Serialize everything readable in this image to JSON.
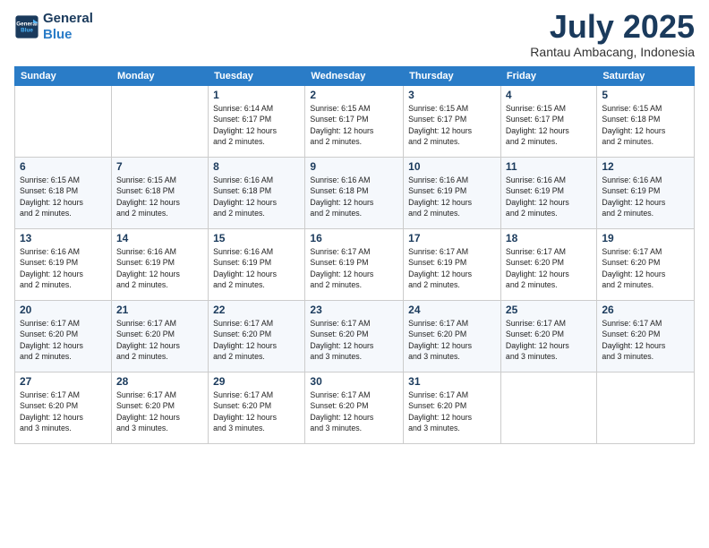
{
  "logo": {
    "line1": "General",
    "line2": "Blue"
  },
  "title": "July 2025",
  "location": "Rantau Ambacang, Indonesia",
  "days_of_week": [
    "Sunday",
    "Monday",
    "Tuesday",
    "Wednesday",
    "Thursday",
    "Friday",
    "Saturday"
  ],
  "weeks": [
    [
      {
        "day": "",
        "info": ""
      },
      {
        "day": "",
        "info": ""
      },
      {
        "day": "1",
        "info": "Sunrise: 6:14 AM\nSunset: 6:17 PM\nDaylight: 12 hours\nand 2 minutes."
      },
      {
        "day": "2",
        "info": "Sunrise: 6:15 AM\nSunset: 6:17 PM\nDaylight: 12 hours\nand 2 minutes."
      },
      {
        "day": "3",
        "info": "Sunrise: 6:15 AM\nSunset: 6:17 PM\nDaylight: 12 hours\nand 2 minutes."
      },
      {
        "day": "4",
        "info": "Sunrise: 6:15 AM\nSunset: 6:17 PM\nDaylight: 12 hours\nand 2 minutes."
      },
      {
        "day": "5",
        "info": "Sunrise: 6:15 AM\nSunset: 6:18 PM\nDaylight: 12 hours\nand 2 minutes."
      }
    ],
    [
      {
        "day": "6",
        "info": "Sunrise: 6:15 AM\nSunset: 6:18 PM\nDaylight: 12 hours\nand 2 minutes."
      },
      {
        "day": "7",
        "info": "Sunrise: 6:15 AM\nSunset: 6:18 PM\nDaylight: 12 hours\nand 2 minutes."
      },
      {
        "day": "8",
        "info": "Sunrise: 6:16 AM\nSunset: 6:18 PM\nDaylight: 12 hours\nand 2 minutes."
      },
      {
        "day": "9",
        "info": "Sunrise: 6:16 AM\nSunset: 6:18 PM\nDaylight: 12 hours\nand 2 minutes."
      },
      {
        "day": "10",
        "info": "Sunrise: 6:16 AM\nSunset: 6:19 PM\nDaylight: 12 hours\nand 2 minutes."
      },
      {
        "day": "11",
        "info": "Sunrise: 6:16 AM\nSunset: 6:19 PM\nDaylight: 12 hours\nand 2 minutes."
      },
      {
        "day": "12",
        "info": "Sunrise: 6:16 AM\nSunset: 6:19 PM\nDaylight: 12 hours\nand 2 minutes."
      }
    ],
    [
      {
        "day": "13",
        "info": "Sunrise: 6:16 AM\nSunset: 6:19 PM\nDaylight: 12 hours\nand 2 minutes."
      },
      {
        "day": "14",
        "info": "Sunrise: 6:16 AM\nSunset: 6:19 PM\nDaylight: 12 hours\nand 2 minutes."
      },
      {
        "day": "15",
        "info": "Sunrise: 6:16 AM\nSunset: 6:19 PM\nDaylight: 12 hours\nand 2 minutes."
      },
      {
        "day": "16",
        "info": "Sunrise: 6:17 AM\nSunset: 6:19 PM\nDaylight: 12 hours\nand 2 minutes."
      },
      {
        "day": "17",
        "info": "Sunrise: 6:17 AM\nSunset: 6:19 PM\nDaylight: 12 hours\nand 2 minutes."
      },
      {
        "day": "18",
        "info": "Sunrise: 6:17 AM\nSunset: 6:20 PM\nDaylight: 12 hours\nand 2 minutes."
      },
      {
        "day": "19",
        "info": "Sunrise: 6:17 AM\nSunset: 6:20 PM\nDaylight: 12 hours\nand 2 minutes."
      }
    ],
    [
      {
        "day": "20",
        "info": "Sunrise: 6:17 AM\nSunset: 6:20 PM\nDaylight: 12 hours\nand 2 minutes."
      },
      {
        "day": "21",
        "info": "Sunrise: 6:17 AM\nSunset: 6:20 PM\nDaylight: 12 hours\nand 2 minutes."
      },
      {
        "day": "22",
        "info": "Sunrise: 6:17 AM\nSunset: 6:20 PM\nDaylight: 12 hours\nand 2 minutes."
      },
      {
        "day": "23",
        "info": "Sunrise: 6:17 AM\nSunset: 6:20 PM\nDaylight: 12 hours\nand 3 minutes."
      },
      {
        "day": "24",
        "info": "Sunrise: 6:17 AM\nSunset: 6:20 PM\nDaylight: 12 hours\nand 3 minutes."
      },
      {
        "day": "25",
        "info": "Sunrise: 6:17 AM\nSunset: 6:20 PM\nDaylight: 12 hours\nand 3 minutes."
      },
      {
        "day": "26",
        "info": "Sunrise: 6:17 AM\nSunset: 6:20 PM\nDaylight: 12 hours\nand 3 minutes."
      }
    ],
    [
      {
        "day": "27",
        "info": "Sunrise: 6:17 AM\nSunset: 6:20 PM\nDaylight: 12 hours\nand 3 minutes."
      },
      {
        "day": "28",
        "info": "Sunrise: 6:17 AM\nSunset: 6:20 PM\nDaylight: 12 hours\nand 3 minutes."
      },
      {
        "day": "29",
        "info": "Sunrise: 6:17 AM\nSunset: 6:20 PM\nDaylight: 12 hours\nand 3 minutes."
      },
      {
        "day": "30",
        "info": "Sunrise: 6:17 AM\nSunset: 6:20 PM\nDaylight: 12 hours\nand 3 minutes."
      },
      {
        "day": "31",
        "info": "Sunrise: 6:17 AM\nSunset: 6:20 PM\nDaylight: 12 hours\nand 3 minutes."
      },
      {
        "day": "",
        "info": ""
      },
      {
        "day": "",
        "info": ""
      }
    ]
  ]
}
